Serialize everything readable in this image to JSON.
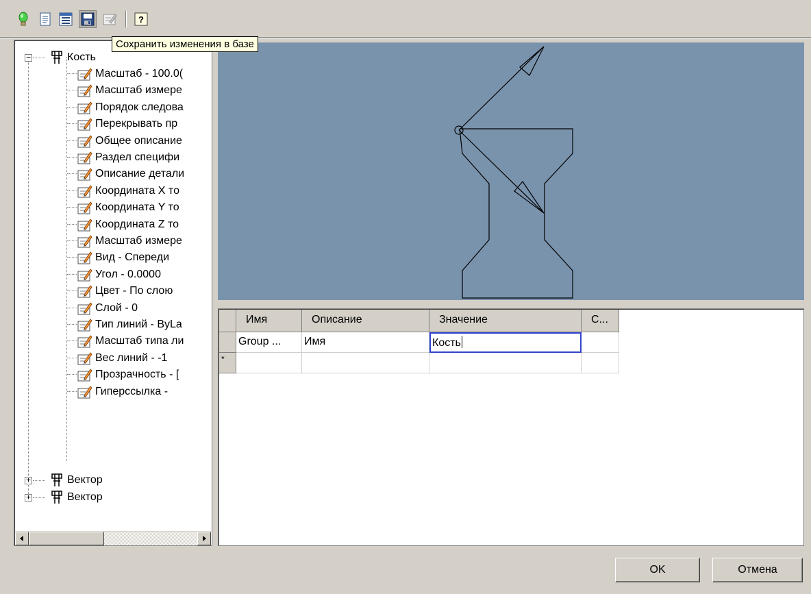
{
  "toolbar": {
    "buttons": [
      {
        "icon": "lightbulb-icon",
        "color": "#2eb82e"
      },
      {
        "icon": "document-icon"
      },
      {
        "icon": "properties-icon"
      },
      {
        "icon": "save-icon",
        "pressed": true
      },
      {
        "icon": "edit-properties-icon",
        "disabled": true
      },
      {
        "icon": "help-icon"
      }
    ],
    "tooltip": "Сохранить изменения в базе"
  },
  "tree": {
    "root": {
      "label": "Кость",
      "expanded": true
    },
    "children": [
      "Масштаб - 100.0(",
      "Масштаб измере",
      "Порядок следова",
      "Перекрывать пр",
      "Общее описание",
      "Раздел специфи",
      "Описание детали",
      "Координата X то",
      "Координата Y то",
      "Координата Z то",
      "Масштаб измере",
      "Вид - Спереди",
      "Угол - 0.0000",
      "Цвет - По слою",
      "Слой - 0",
      "Тип линий - ByLa",
      "Масштаб типа ли",
      "Вес линий - -1",
      "Прозрачность - [",
      "Гиперссылка -"
    ],
    "siblings": [
      {
        "label": "Вектор",
        "expanded": false
      },
      {
        "label": "Вектор",
        "expanded": false
      }
    ]
  },
  "preview": {
    "background": "#7a93ad",
    "stroke": "#000000"
  },
  "grid": {
    "columns": [
      "Имя",
      "Описание",
      "Значение",
      "С..."
    ],
    "rows": [
      {
        "marker": "",
        "cells": [
          "Group ...",
          "Имя",
          "Кость",
          ""
        ]
      },
      {
        "marker": "*",
        "cells": [
          "",
          "",
          "",
          ""
        ]
      }
    ]
  },
  "buttons": {
    "ok": "OK",
    "cancel": "Отмена"
  }
}
